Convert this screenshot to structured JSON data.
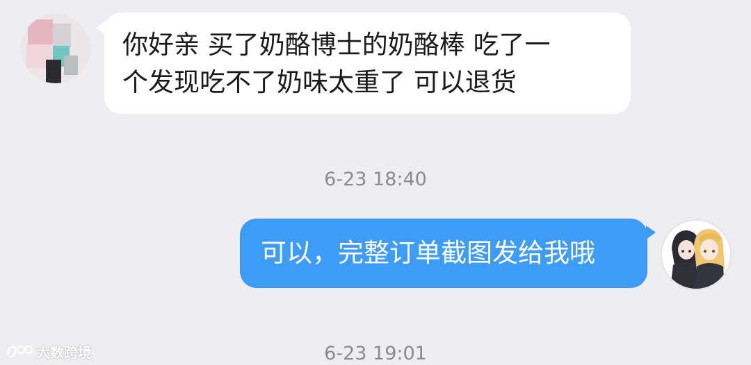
{
  "messages": [
    {
      "direction": "incoming",
      "line1": "你好亲 买了奶酪博士的奶酪棒 吃了一",
      "line2": "个发现吃不了奶味太重了 可以退货"
    },
    {
      "direction": "outgoing",
      "text": "可以，完整订单截图发给我哦"
    }
  ],
  "timestamps": [
    "6-23 18:40",
    "6-23 19:01"
  ],
  "watermark": {
    "text": "大数跨境"
  },
  "colors": {
    "background": "#eeeef0",
    "incoming_bubble": "#ffffff",
    "outgoing_bubble": "#3d9cf5",
    "timestamp_text": "#8a8a8f"
  }
}
